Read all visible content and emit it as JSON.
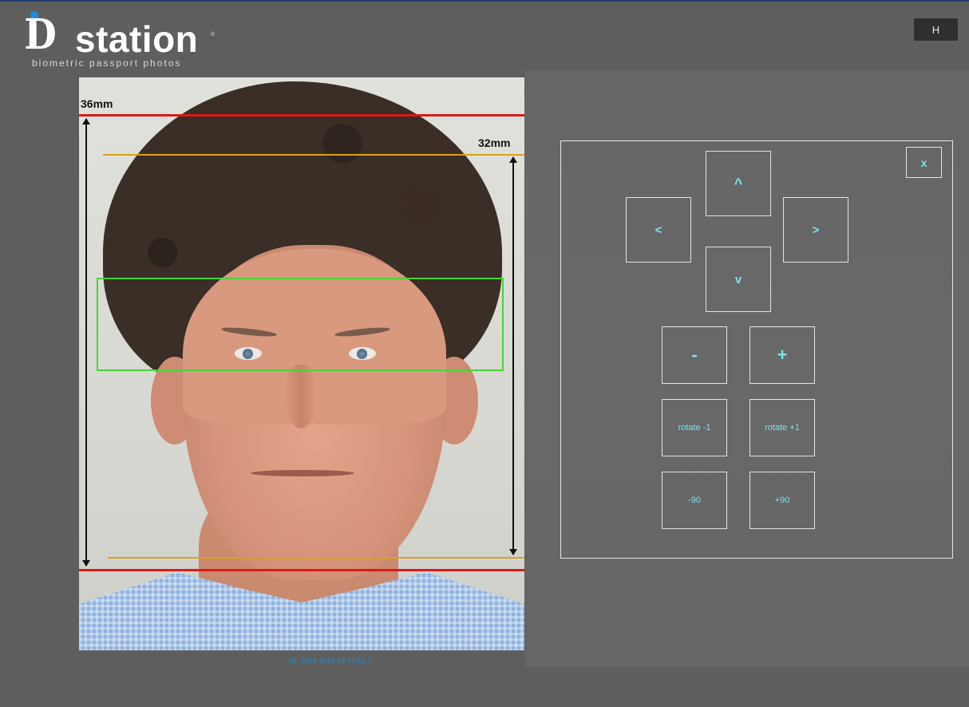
{
  "logo": {
    "i": "i",
    "d": "D",
    "word": "station",
    "tm": "®",
    "tagline": "biometric passport photos"
  },
  "header": {
    "h_button": "H"
  },
  "photo": {
    "label_top": "36mm",
    "label_inner": "32mm",
    "timestamp": "ID: 2016 2015 16:47:52.7"
  },
  "controls": {
    "close": "x",
    "up": "^",
    "left": "<",
    "right": ">",
    "down": "v",
    "zoom_out": "-",
    "zoom_in": "+",
    "rotate_minus": "rotate -1",
    "rotate_plus": "rotate +1",
    "rotate_minus_90": "-90",
    "rotate_plus_90": "+90"
  },
  "colors": {
    "background": "#5e5e5e",
    "accent_text": "#7ee3f0",
    "guide_red": "#e01818",
    "guide_yellow": "#d9a21a",
    "guide_green": "#47d43a",
    "logo_blue": "#1e8fd8"
  }
}
